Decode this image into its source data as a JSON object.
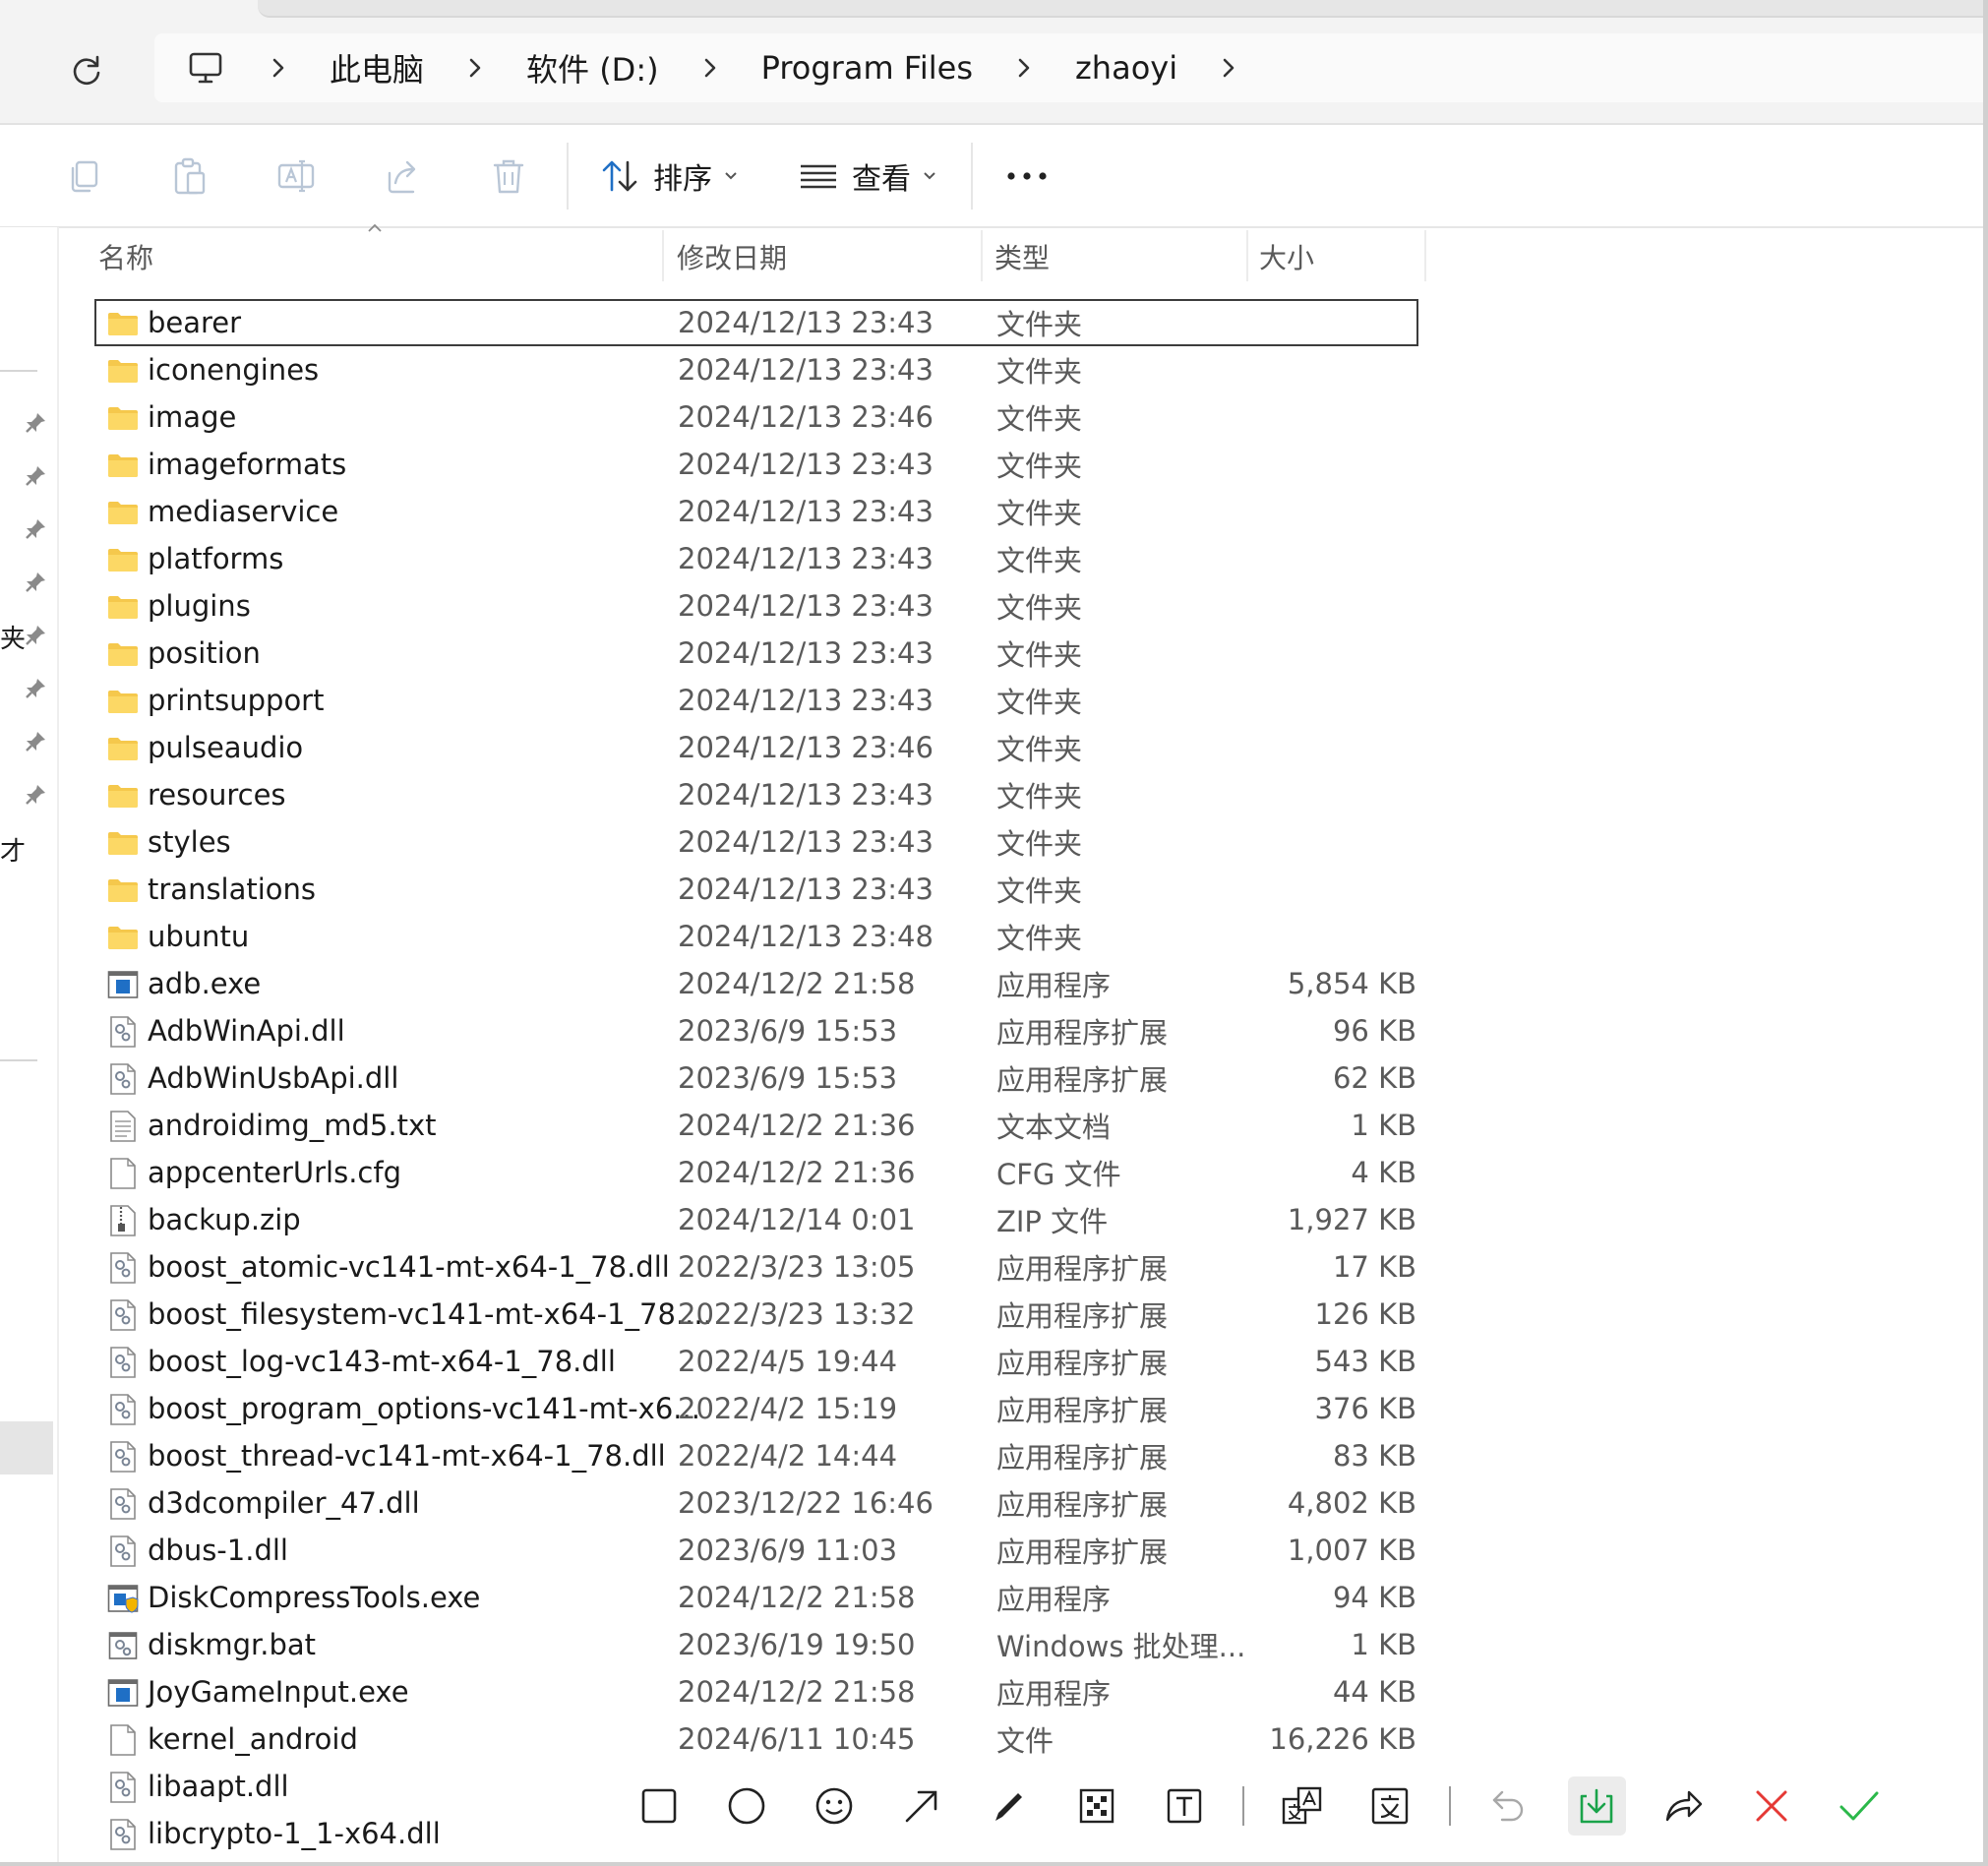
{
  "breadcrumb": {
    "items": [
      {
        "label": "此电脑"
      },
      {
        "label": "软件 (D:)"
      },
      {
        "label": "Program Files"
      },
      {
        "label": "zhaoyi"
      }
    ]
  },
  "toolbar": {
    "sort_label": "排序",
    "view_label": "查看"
  },
  "nav_pane": {
    "fragment_1": "夹",
    "fragment_2": "才"
  },
  "columns": {
    "name": "名称",
    "date": "修改日期",
    "type": "类型",
    "size": "大小"
  },
  "files": [
    {
      "name": "bearer",
      "date": "2024/12/13 23:43",
      "type": "文件夹",
      "size": "",
      "icon": "folder-icon"
    },
    {
      "name": "iconengines",
      "date": "2024/12/13 23:43",
      "type": "文件夹",
      "size": "",
      "icon": "folder-icon"
    },
    {
      "name": "image",
      "date": "2024/12/13 23:46",
      "type": "文件夹",
      "size": "",
      "icon": "folder-icon"
    },
    {
      "name": "imageformats",
      "date": "2024/12/13 23:43",
      "type": "文件夹",
      "size": "",
      "icon": "folder-icon"
    },
    {
      "name": "mediaservice",
      "date": "2024/12/13 23:43",
      "type": "文件夹",
      "size": "",
      "icon": "folder-icon"
    },
    {
      "name": "platforms",
      "date": "2024/12/13 23:43",
      "type": "文件夹",
      "size": "",
      "icon": "folder-icon"
    },
    {
      "name": "plugins",
      "date": "2024/12/13 23:43",
      "type": "文件夹",
      "size": "",
      "icon": "folder-icon"
    },
    {
      "name": "position",
      "date": "2024/12/13 23:43",
      "type": "文件夹",
      "size": "",
      "icon": "folder-icon"
    },
    {
      "name": "printsupport",
      "date": "2024/12/13 23:43",
      "type": "文件夹",
      "size": "",
      "icon": "folder-icon"
    },
    {
      "name": "pulseaudio",
      "date": "2024/12/13 23:46",
      "type": "文件夹",
      "size": "",
      "icon": "folder-icon"
    },
    {
      "name": "resources",
      "date": "2024/12/13 23:43",
      "type": "文件夹",
      "size": "",
      "icon": "folder-icon"
    },
    {
      "name": "styles",
      "date": "2024/12/13 23:43",
      "type": "文件夹",
      "size": "",
      "icon": "folder-icon"
    },
    {
      "name": "translations",
      "date": "2024/12/13 23:43",
      "type": "文件夹",
      "size": "",
      "icon": "folder-icon"
    },
    {
      "name": "ubuntu",
      "date": "2024/12/13 23:48",
      "type": "文件夹",
      "size": "",
      "icon": "folder-icon"
    },
    {
      "name": "adb.exe",
      "date": "2024/12/2 21:58",
      "type": "应用程序",
      "size": "5,854 KB",
      "icon": "exe-icon"
    },
    {
      "name": "AdbWinApi.dll",
      "date": "2023/6/9 15:53",
      "type": "应用程序扩展",
      "size": "96 KB",
      "icon": "dll-icon"
    },
    {
      "name": "AdbWinUsbApi.dll",
      "date": "2023/6/9 15:53",
      "type": "应用程序扩展",
      "size": "62 KB",
      "icon": "dll-icon"
    },
    {
      "name": "androidimg_md5.txt",
      "date": "2024/12/2 21:36",
      "type": "文本文档",
      "size": "1 KB",
      "icon": "text-file-icon"
    },
    {
      "name": "appcenterUrls.cfg",
      "date": "2024/12/2 21:36",
      "type": "CFG 文件",
      "size": "4 KB",
      "icon": "blank-file-icon"
    },
    {
      "name": "backup.zip",
      "date": "2024/12/14 0:01",
      "type": "ZIP 文件",
      "size": "1,927 KB",
      "icon": "zip-icon"
    },
    {
      "name": "boost_atomic-vc141-mt-x64-1_78.dll",
      "date": "2022/3/23 13:05",
      "type": "应用程序扩展",
      "size": "17 KB",
      "icon": "dll-icon"
    },
    {
      "name": "boost_filesystem-vc141-mt-x64-1_78....",
      "date": "2022/3/23 13:32",
      "type": "应用程序扩展",
      "size": "126 KB",
      "icon": "dll-icon"
    },
    {
      "name": "boost_log-vc143-mt-x64-1_78.dll",
      "date": "2022/4/5 19:44",
      "type": "应用程序扩展",
      "size": "543 KB",
      "icon": "dll-icon"
    },
    {
      "name": "boost_program_options-vc141-mt-x6...",
      "date": "2022/4/2 15:19",
      "type": "应用程序扩展",
      "size": "376 KB",
      "icon": "dll-icon"
    },
    {
      "name": "boost_thread-vc141-mt-x64-1_78.dll",
      "date": "2022/4/2 14:44",
      "type": "应用程序扩展",
      "size": "83 KB",
      "icon": "dll-icon"
    },
    {
      "name": "d3dcompiler_47.dll",
      "date": "2023/12/22 16:46",
      "type": "应用程序扩展",
      "size": "4,802 KB",
      "icon": "dll-icon"
    },
    {
      "name": "dbus-1.dll",
      "date": "2023/6/9 11:03",
      "type": "应用程序扩展",
      "size": "1,007 KB",
      "icon": "dll-icon"
    },
    {
      "name": "DiskCompressTools.exe",
      "date": "2024/12/2 21:58",
      "type": "应用程序",
      "size": "94 KB",
      "icon": "exe-shield-icon"
    },
    {
      "name": "diskmgr.bat",
      "date": "2023/6/19 19:50",
      "type": "Windows 批处理...",
      "size": "1 KB",
      "icon": "bat-icon"
    },
    {
      "name": "JoyGameInput.exe",
      "date": "2024/12/2 21:58",
      "type": "应用程序",
      "size": "44 KB",
      "icon": "exe-icon"
    },
    {
      "name": "kernel_android",
      "date": "2024/6/11 10:45",
      "type": "文件",
      "size": "16,226 KB",
      "icon": "blank-file-icon"
    },
    {
      "name": "libaapt.dll",
      "date": "",
      "type": "",
      "size": "",
      "icon": "dll-icon"
    },
    {
      "name": "libcrypto-1_1-x64.dll",
      "date": "",
      "type": "",
      "size": "",
      "icon": "dll-icon"
    }
  ],
  "colors": {
    "folder": "#f5c84c",
    "accent_blue": "#1f6fc5",
    "save_green": "#1aa34a",
    "cancel_red": "#e53935",
    "confirm_green": "#2bb84a"
  }
}
